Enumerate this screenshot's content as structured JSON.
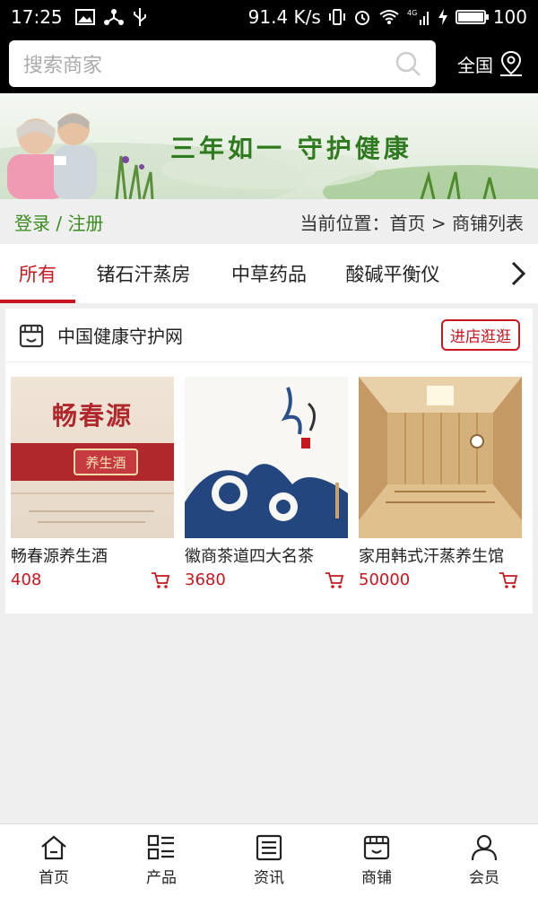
{
  "status_bar": {
    "time": "17:25",
    "net_speed": "91.4 K/s",
    "network": "4G",
    "battery": "100",
    "battery_level": 1.0
  },
  "search": {
    "placeholder": "搜索商家",
    "region_label": "全国"
  },
  "banner": {
    "slogan": "三年如一 守护健康"
  },
  "breadcrumb": {
    "login_register": "登录 / 注册",
    "location": "当前位置：首页 > 商铺列表"
  },
  "tabs": [
    {
      "label": "所有",
      "active": true
    },
    {
      "label": "锗石汗蒸房",
      "active": false
    },
    {
      "label": "中草药品",
      "active": false
    },
    {
      "label": "酸碱平衡仪",
      "active": false
    }
  ],
  "shop": {
    "name": "中国健康守护网",
    "visit_label": "进店逛逛",
    "products": [
      {
        "name": "畅春源养生酒",
        "price": "408",
        "image_icon": "wine-box-image",
        "brand_text": "畅春源",
        "seal_text": "养生酒"
      },
      {
        "name": "徽商茶道四大名茶",
        "price": "3680",
        "image_icon": "tea-box-image"
      },
      {
        "name": "家用韩式汗蒸养生馆",
        "price": "50000",
        "image_icon": "sauna-room-image"
      }
    ]
  },
  "bottom_nav": [
    {
      "label": "首页",
      "icon": "home-icon"
    },
    {
      "label": "产品",
      "icon": "grid-list-icon"
    },
    {
      "label": "资讯",
      "icon": "news-icon"
    },
    {
      "label": "商铺",
      "icon": "store-icon"
    },
    {
      "label": "会员",
      "icon": "user-icon"
    }
  ],
  "colors": {
    "accent": "#c8161e",
    "login_green": "#3a8c1f"
  }
}
